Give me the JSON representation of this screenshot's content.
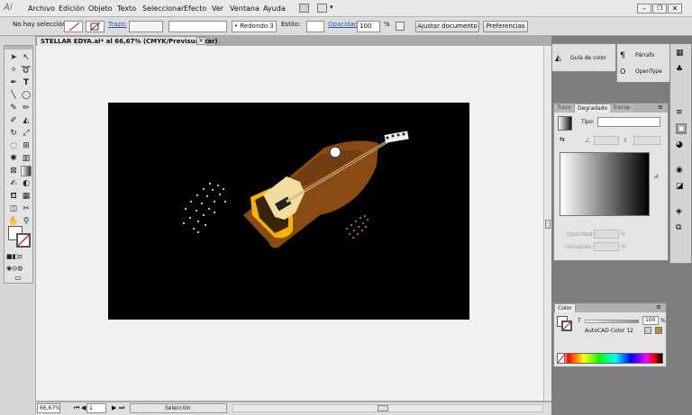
{
  "app": {
    "logo": "Ai"
  },
  "menubar": {
    "items": [
      "Archivo",
      "Edición",
      "Objeto",
      "Texto",
      "Seleccionar",
      "Efecto",
      "Ver",
      "Ventana",
      "Ayuda"
    ]
  },
  "controlbar": {
    "selection_status": "No hay selección",
    "stroke_label": "Trazo:",
    "brush_value": "Redondo 3 pt.",
    "style_label": "Estilo:",
    "opacity_label": "Opacidad:",
    "opacity_value": "100",
    "percent": "%",
    "fit_document_button": "Ajustar documento",
    "preferences_button": "Preferencias"
  },
  "document": {
    "tab_title": "STELLAR EDYA.ai* al 66,67% (CMYK/Previsualizar)",
    "close_glyph": "×"
  },
  "statusbar": {
    "zoom": "66,67%",
    "page": "1",
    "tool": "Selección"
  },
  "panels": {
    "guide": {
      "label": "Guía de color"
    },
    "paragraph": {
      "label": "Párrafo"
    },
    "opentype": {
      "label": "OpenType"
    },
    "gradient": {
      "tabs": [
        "Trazo",
        "Degradado",
        "Transp"
      ],
      "active_tab": "Degradado",
      "tipo_label": "Tipo:",
      "opacity_label": "Opacidad:",
      "location_label": "Ubicación:",
      "percent": "%"
    },
    "color": {
      "tab": "Color",
      "t_label": "T",
      "tint_value": "100",
      "percent": "%",
      "swatch_name": "AutoCAD Color 12"
    }
  },
  "colors": {
    "guitar_body": "#8a4a14",
    "guitar_dark": "#4d2a0c",
    "pickguard": "#f2dca0",
    "flame": "#f4b400"
  },
  "icons": [
    "window-minimize-icon",
    "window-restore-icon",
    "window-close-icon",
    "selection-tool-icon",
    "direct-selection-icon",
    "pen-icon",
    "type-icon",
    "line-icon",
    "ellipse-icon",
    "brush-icon",
    "pencil-icon",
    "rotate-icon",
    "scale-icon",
    "gradient-icon",
    "eyedropper-icon",
    "zoom-icon",
    "hand-icon",
    "fill-swatch-icon",
    "stroke-swatch-icon"
  ]
}
